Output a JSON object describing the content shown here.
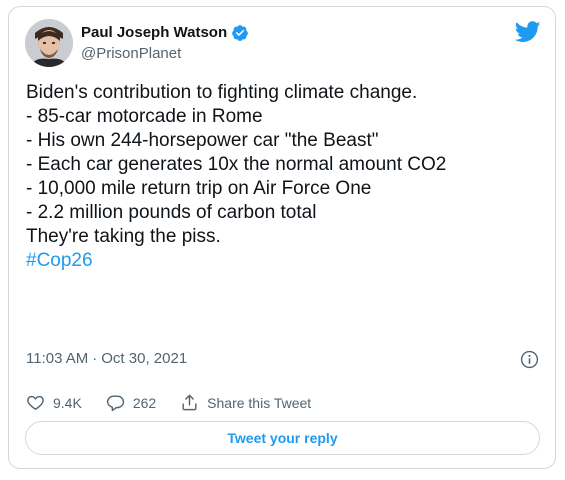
{
  "author": {
    "display_name": "Paul Joseph Watson",
    "handle": "@PrisonPlanet",
    "verified": true
  },
  "tweet": {
    "lines": [
      "Biden's contribution to fighting climate change.",
      "",
      "- 85-car motorcade in Rome",
      "- His own 244-horsepower car \"the Beast\"",
      "- Each car generates 10x the normal amount CO2",
      "- 10,000 mile return trip on Air Force One",
      "- 2.2 million pounds of carbon total",
      "",
      "They're taking the piss.",
      ""
    ],
    "hashtag": "#Cop26"
  },
  "meta": {
    "time": "11:03 AM",
    "separator": "·",
    "date": "Oct 30, 2021"
  },
  "actions": {
    "likes": "9.4K",
    "replies": "262",
    "share_label": "Share this Tweet"
  },
  "reply_button_label": "Tweet your reply",
  "colors": {
    "accent": "#1d9bf0",
    "text": "#0f1419",
    "secondary": "#536471",
    "border": "#cfd9de"
  }
}
